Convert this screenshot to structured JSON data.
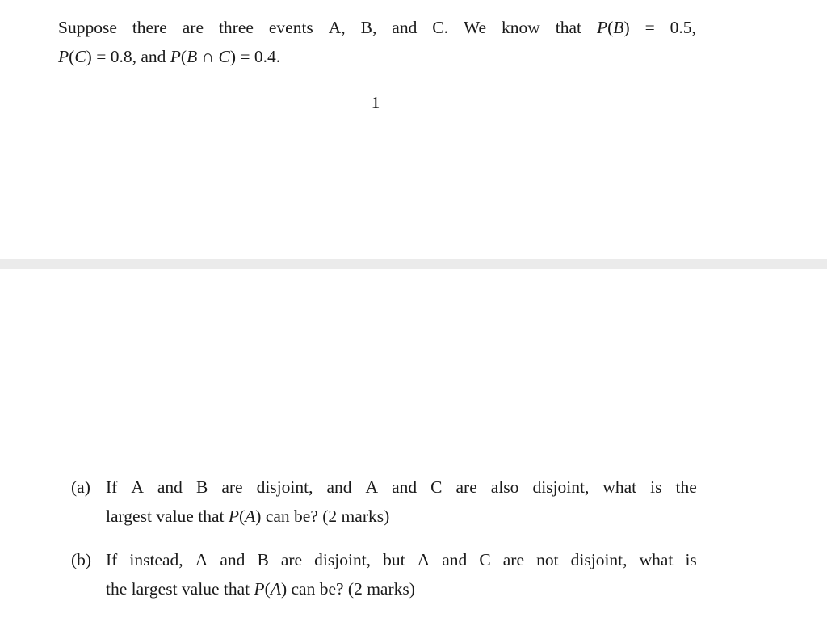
{
  "document": {
    "page1": {
      "intro": {
        "line1_words": [
          "Suppose",
          "there",
          "are",
          "three",
          "events",
          "A,",
          "B,",
          "and",
          "C.",
          "We",
          "know",
          "that",
          "P(B)",
          "=",
          "0.5,"
        ],
        "line1_text": "Suppose there are three events A, B, and C. We know that P(B) = 0.5,",
        "line2_text": "P(C) = 0.8, and P(B ∩ C) = 0.4.",
        "given": {
          "P_B": "0.5",
          "P_C": "0.8",
          "P_B_and_C": "0.4"
        }
      },
      "page_number": "1"
    },
    "page2": {
      "questions": [
        {
          "label": "(a)",
          "line1_words": [
            "If",
            "A",
            "and",
            "B",
            "are",
            "disjoint,",
            "and",
            "A",
            "and",
            "C",
            "are",
            "also",
            "disjoint,",
            "what",
            "is",
            "the"
          ],
          "line1_text": "If A and B are disjoint, and A and C are also disjoint, what is the",
          "line2_text": "largest value that P(A) can be? (2 marks)",
          "marks": "(2 marks)"
        },
        {
          "label": "(b)",
          "line1_words": [
            "If",
            "instead,",
            "A",
            "and",
            "B",
            "are",
            "disjoint,",
            "but",
            "A",
            "and",
            "C",
            "are",
            "not",
            "disjoint,",
            "what",
            "is"
          ],
          "line1_text": "If instead, A and B are disjoint, but A and C are not disjoint, what is",
          "line2_text": "the largest value that P(A) can be? (2 marks)",
          "marks": "(2 marks)"
        }
      ]
    }
  }
}
